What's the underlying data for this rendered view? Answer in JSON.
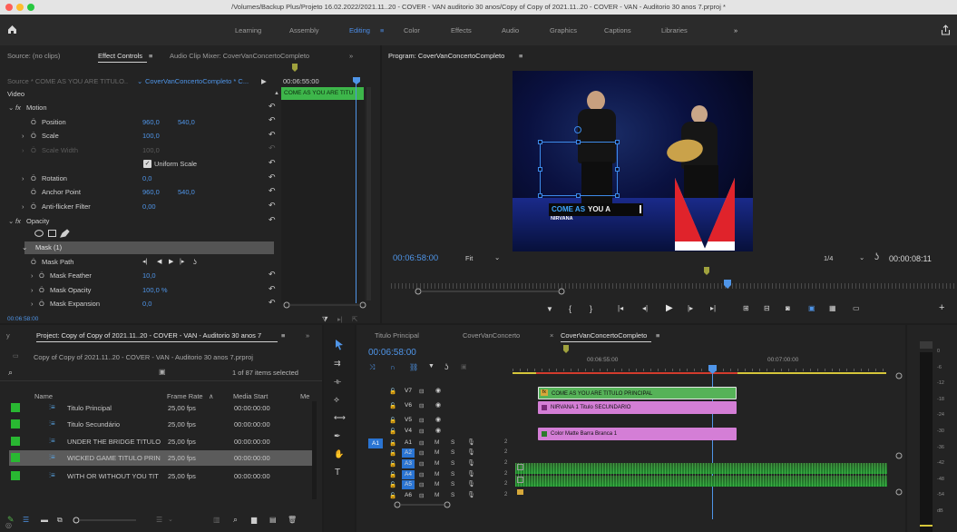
{
  "titlebar": {
    "title": "/Volumes/Backup Plus/Projeto 16.02.2022/2021.11..20 - COVER - VAN auditorio 30 anos/Copy of Copy of 2021.11..20 - COVER - VAN - Auditorio 30 anos 7.prproj *"
  },
  "workspaces": [
    "Learning",
    "Assembly",
    "Editing",
    "Color",
    "Effects",
    "Audio",
    "Graphics",
    "Captions",
    "Libraries"
  ],
  "workspace_more": "»",
  "source": {
    "tabs": [
      "Source: (no clips)",
      "Effect Controls",
      "Audio Clip Mixer: CoverVanConcertoCompleto"
    ],
    "tab_menu": "≡",
    "more": "»",
    "source_line": "Source * COME AS YOU ARE TITULO..",
    "sequence_line": "CoverVanConcertoCompleto * C...",
    "play_mark": "▶",
    "ruler_time": "00:06:55:00",
    "clip_label": "COME AS YOU ARE TITU",
    "section_video": "Video",
    "rows": {
      "motion": "Motion",
      "position": "Position",
      "pos_x": "960,0",
      "pos_y": "540,0",
      "scale": "Scale",
      "scale_v": "100,0",
      "scale_width": "Scale Width",
      "scale_width_v": "100,0",
      "uniform": "Uniform Scale",
      "rotation": "Rotation",
      "rotation_v": "0,0",
      "anchor": "Anchor Point",
      "anchor_x": "960,0",
      "anchor_y": "540,0",
      "antiflicker": "Anti-flicker Filter",
      "antiflicker_v": "0,00",
      "opacity": "Opacity",
      "mask": "Mask (1)",
      "mask_path": "Mask Path",
      "mask_feather": "Mask Feather",
      "mask_feather_v": "10,0",
      "mask_opacity": "Mask Opacity",
      "mask_opacity_v": "100,0 %",
      "mask_expansion": "Mask Expansion",
      "mask_expansion_v": "0,0"
    },
    "fx": "fx",
    "timecode": "00:06:58:00"
  },
  "program": {
    "title": "Program: CoverVanConcertoCompleto",
    "menu": "≡",
    "timecode": "00:06:58:00",
    "fit": "Fit",
    "fraction": "1/4",
    "duration": "00:00:08:11",
    "title_overlay_a": "COME AS",
    "title_overlay_b": "YOU A",
    "title_overlay_sub": "NIRVANA"
  },
  "project": {
    "title": "Project: Copy of Copy of 2021.11..20 - COVER - VAN - Auditorio 30 anos 7",
    "menu": "≡",
    "more": "»",
    "file": "Copy of Copy of 2021.11..20 - COVER - VAN - Auditorio 30 anos 7.prproj",
    "count": "1 of 87 items selected",
    "columns": [
      "Name",
      "Frame Rate",
      "Media Start",
      "Me"
    ],
    "sort_arrow": "∧",
    "items": [
      {
        "name": "Titulo Principal",
        "fps": "25,00 fps",
        "start": "00:00:00:00"
      },
      {
        "name": "Titulo Secundário",
        "fps": "25,00 fps",
        "start": "00:00:00:00"
      },
      {
        "name": "UNDER THE BRIDGE TITULO",
        "fps": "25,00 fps",
        "start": "00:00:00:00"
      },
      {
        "name": "WICKED GAME TITULO PRIN",
        "fps": "25,00 fps",
        "start": "00:00:00:00"
      },
      {
        "name": "WITH OR WITHOUT YOU TIT",
        "fps": "25,00 fps",
        "start": "00:00:00:00"
      }
    ],
    "selected_index": 3
  },
  "timeline": {
    "tabs": [
      "Titulo Principal",
      "CoverVanConcerto",
      "CoverVanConcertoCompleto"
    ],
    "close": "×",
    "menu": "≡",
    "timecode": "00:06:58:00",
    "ruler": [
      "00:06:55:00",
      "00:07:00:00"
    ],
    "tracks": [
      "V7",
      "V6",
      "V5",
      "V4",
      "A1",
      "A2",
      "A3",
      "A4",
      "A5",
      "A6"
    ],
    "source_patch": "A1",
    "mute": "M",
    "solo": "S",
    "channels": "2",
    "clips": [
      {
        "label": "COME AS YOU ARE TITULO PRINCIPAL",
        "color": "#56b258"
      },
      {
        "label": "NIRVANA 1 Titulo SECUNDARIO",
        "color": "#d47ed6"
      },
      {
        "label": "Color Matte Barra Branca 1",
        "color": "#d47ed6"
      }
    ]
  },
  "meter": {
    "scale": [
      "0",
      "-6",
      "-12",
      "-18",
      "-24",
      "-30",
      "-36",
      "-42",
      "-48",
      "-54",
      "dB"
    ]
  },
  "colors": {
    "accent": "#4c8ee8",
    "program_red": "#e0232b",
    "selection": "#5b5b5b"
  }
}
